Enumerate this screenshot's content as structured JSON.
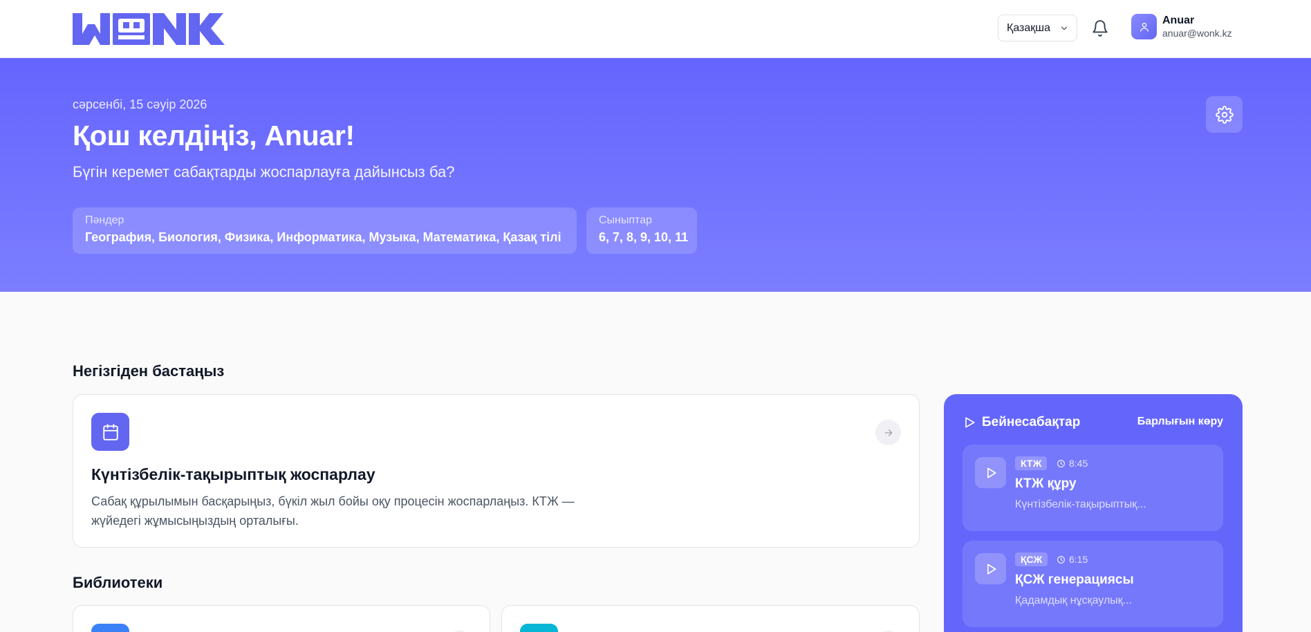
{
  "brand": {
    "logo_text": "WONK",
    "accent": "#6366f1"
  },
  "header": {
    "language": "Қазақша",
    "user": {
      "name": "Anuar",
      "email": "anuar@wonk.kz"
    }
  },
  "hero": {
    "date": "сәрсенбі, 15 сәуір 2026",
    "title": "Қош келдіңіз, Anuar!",
    "subtitle": "Бүгін керемет сабақтарды жоспарлауға дайынсыз ба?",
    "subjects": {
      "label": "Пәндер",
      "value": "География, Биология, Физика, Информатика, Музыка, Математика, Қазақ тілі"
    },
    "grades": {
      "label": "Сыныптар",
      "value": "6, 7, 8, 9, 10, 11"
    }
  },
  "main": {
    "start_title": "Негізгіден бастаңыз",
    "start_card": {
      "title": "Күнтізбелік-тақырыптық жоспарлау",
      "description": "Сабақ құрылымын басқарыңыз, бүкіл жыл бойы оқу процесін жоспарлаңыз. КТЖ — жүйедегі жұмысыңыздың орталығы."
    },
    "libraries_title": "Библиотеки",
    "library_colors": [
      "#3b82f6",
      "#06b6d4"
    ]
  },
  "videos": {
    "title": "Бейнесабақтар",
    "view_all": "Барлығын көру",
    "items": [
      {
        "badge": "КТЖ",
        "duration": "8:45",
        "title": "КТЖ құру",
        "description": "Күнтізбелік-тақырыптық..."
      },
      {
        "badge": "ҚСЖ",
        "duration": "6:15",
        "title": "ҚСЖ генерациясы",
        "description": "Қадамдық нұсқаулық..."
      }
    ]
  }
}
